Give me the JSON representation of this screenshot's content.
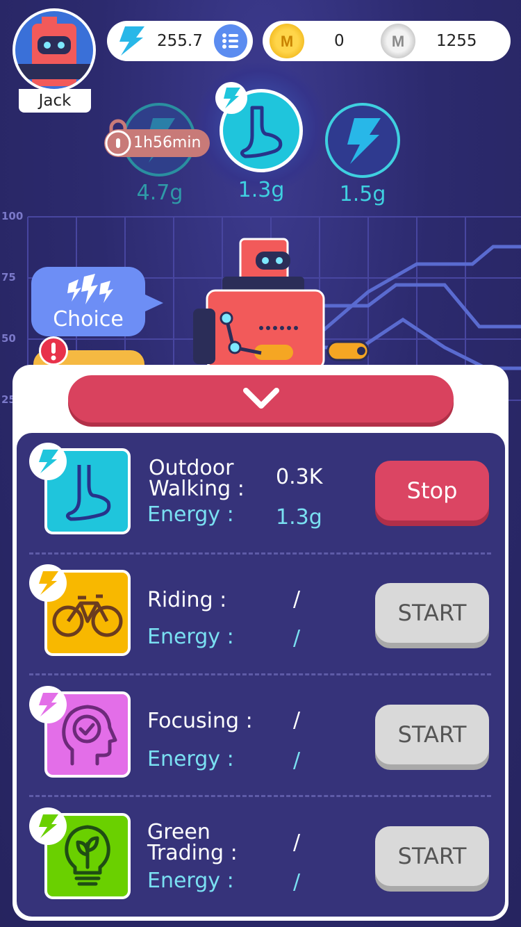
{
  "user": {
    "name": "Jack"
  },
  "header": {
    "energy_balance": "255.7",
    "gold_coins": "0",
    "silver_coins": "1255"
  },
  "chart_axis": {
    "ticks": [
      "100",
      "75",
      "50",
      "25"
    ]
  },
  "energy_bubbles": [
    {
      "label": "4.7g",
      "locked": true,
      "timer": "1h56min",
      "icon": "lightning-icon"
    },
    {
      "label": "1.3g",
      "active": true,
      "icon": "foot-icon"
    },
    {
      "label": "1.5g",
      "icon": "lightning-icon"
    }
  ],
  "choice": {
    "label": "Choice"
  },
  "activities": [
    {
      "name": "Outdoor\nWalking :",
      "value": "0.3K",
      "energy_label": "Energy :",
      "energy": "1.3g",
      "button": "Stop",
      "icon": "foot-icon",
      "color": "#1fc5dc"
    },
    {
      "name": "Riding :",
      "value": "/",
      "energy_label": "Energy :",
      "energy": "/",
      "button": "START",
      "icon": "bicycle-icon",
      "color": "#f8b800"
    },
    {
      "name": "Focusing :",
      "value": "/",
      "energy_label": "Energy :",
      "energy": "/",
      "button": "START",
      "icon": "head-focus-icon",
      "color": "#e36ee8"
    },
    {
      "name": "Green\nTrading :",
      "value": "/",
      "energy_label": "Energy :",
      "energy": "/",
      "button": "START",
      "icon": "lightbulb-leaf-icon",
      "color": "#6ad000"
    }
  ],
  "colors": {
    "accent_red": "#d9425e",
    "energy_cyan": "#3fd0e0",
    "panel_bg": "#36337a"
  }
}
